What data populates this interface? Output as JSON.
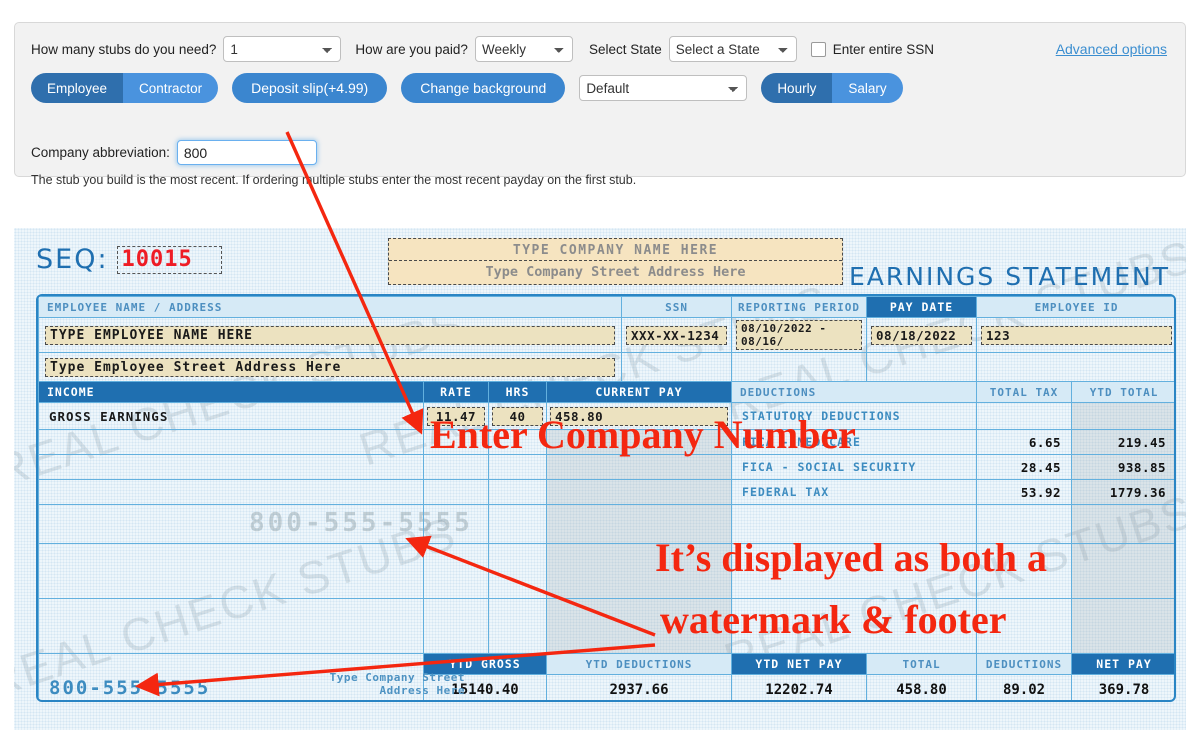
{
  "form": {
    "stubs_label": "How many stubs do you need?",
    "stubs_value": "1",
    "paid_label": "How are you paid?",
    "paid_value": "Weekly",
    "state_label": "Select State",
    "state_value": "Select a State",
    "ssn_checkbox_label": "Enter entire SSN",
    "advanced_options": "Advanced options",
    "employee_tab": "Employee",
    "contractor_tab": "Contractor",
    "deposit_slip_button": "Deposit slip(+4.99)",
    "change_background_button": "Change background",
    "background_value": "Default",
    "hourly_tab": "Hourly",
    "salary_tab": "Salary",
    "abbreviation_label": "Company abbreviation:",
    "abbreviation_value": "800",
    "hint": "The stub you build is the most recent. If ordering multiple stubs enter the most recent payday on the first stub."
  },
  "stub": {
    "seq_label": "SEQ:",
    "seq_value": "10015",
    "company_name": "TYPE COMPANY NAME HERE",
    "company_address": "Type Company Street Address Here",
    "earnings_title": "EARNINGS STATEMENT",
    "employee_header": "EMPLOYEE NAME / ADDRESS",
    "employee_name": "TYPE EMPLOYEE NAME HERE",
    "employee_address": "Type Employee Street Address Here",
    "ssn_header": "SSN",
    "ssn_value": "XXX-XX-1234",
    "period_header": "REPORTING PERIOD",
    "period_value": "08/10/2022 - 08/16/",
    "paydate_header": "PAY DATE",
    "paydate_value": "08/18/2022",
    "empid_header": "EMPLOYEE ID",
    "empid_value": "123",
    "income_header": "INCOME",
    "rate_header": "RATE",
    "hrs_header": "HRS",
    "current_pay_header": "CURRENT PAY",
    "gross_earnings_label": "GROSS EARNINGS",
    "gross_rate": "11.47",
    "gross_hrs": "40",
    "gross_current_pay": "458.80",
    "deductions_header": "DEDUCTIONS",
    "total_tax_header": "TOTAL TAX",
    "ytd_total_header": "YTD TOTAL",
    "statutory_label": "STATUTORY DEDUCTIONS",
    "deduction_rows": [
      {
        "label": "FICA - MEDICARE",
        "total_tax": "6.65",
        "ytd_total": "219.45"
      },
      {
        "label": "FICA - SOCIAL SECURITY",
        "total_tax": "28.45",
        "ytd_total": "938.85"
      },
      {
        "label": "FEDERAL TAX",
        "total_tax": "53.92",
        "ytd_total": "1779.36"
      }
    ],
    "footer_phone": "800-555-5555",
    "footer_address_line1": "Type Company Street",
    "footer_address_line2": "Address Here",
    "totals_headers": [
      "YTD GROSS",
      "YTD DEDUCTIONS",
      "YTD NET PAY",
      "TOTAL",
      "DEDUCTIONS",
      "NET PAY"
    ],
    "totals_values": [
      "15140.40",
      "2937.66",
      "12202.74",
      "458.80",
      "89.02",
      "369.78"
    ],
    "watermark_text": "REAL CHECK STUBS",
    "watermark_phone": "800-555-5555"
  },
  "annotations": {
    "line1": "Enter Company Number",
    "line2": "It’s displayed as both a",
    "line3": "watermark & footer"
  },
  "colors": {
    "accent_blue": "#1f6fb0",
    "pill_on": "#2f6fad",
    "pill_off": "#4a93de",
    "button_blue": "#3b86cf",
    "link_blue": "#3b8ed0",
    "annotation_red": "#f42710",
    "seq_red": "#ee1c25",
    "fill_tan": "#ece2c0"
  }
}
